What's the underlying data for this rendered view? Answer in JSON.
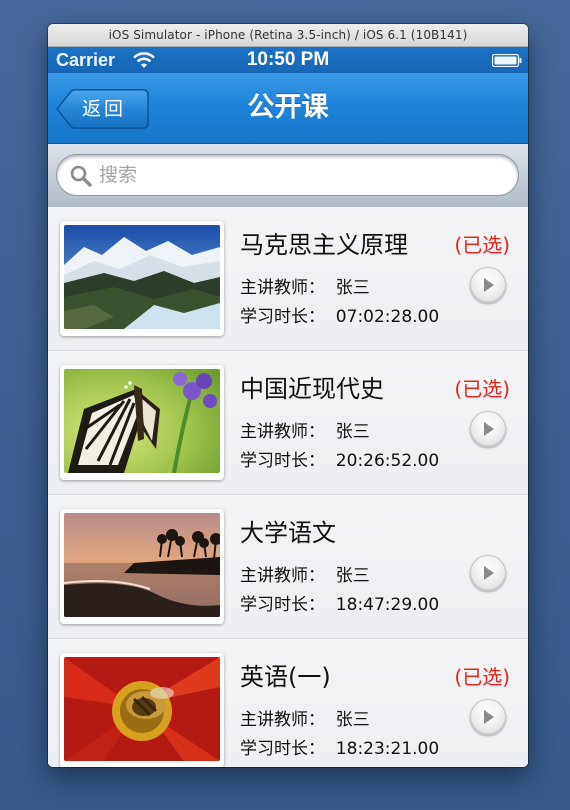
{
  "simulator": {
    "title": "iOS Simulator - iPhone (Retina 3.5-inch) / iOS 6.1 (10B141)"
  },
  "status_bar": {
    "carrier": "Carrier",
    "time": "10:50 PM",
    "icons": [
      "wifi-icon",
      "battery-icon"
    ]
  },
  "nav": {
    "back_label": "返回",
    "title": "公开课"
  },
  "search": {
    "placeholder": "搜索",
    "value": ""
  },
  "courses": [
    {
      "name": "马克思主义原理",
      "status": "(已选)",
      "teacher": "主讲教师：  张三",
      "duration": "学习时长：  07:02:28.00",
      "thumbnail": "mountain-landscape"
    },
    {
      "name": "中国近现代史",
      "status": "(已选)",
      "teacher": "主讲教师：  张三",
      "duration": "学习时长：  20:26:52.00",
      "thumbnail": "butterfly"
    },
    {
      "name": "大学语文",
      "status": "",
      "teacher": "主讲教师：  张三",
      "duration": "学习时长：  18:47:29.00",
      "thumbnail": "beach-sunset"
    },
    {
      "name": "英语(一)",
      "status": "(已选)",
      "teacher": "主讲教师：  张三",
      "duration": "学习时长：  18:23:21.00",
      "thumbnail": "bee-on-flower"
    }
  ],
  "colors": {
    "nav_blue": "#1f84d9",
    "selected_red": "#e0251d",
    "desktop_blue": "#3f6296"
  }
}
